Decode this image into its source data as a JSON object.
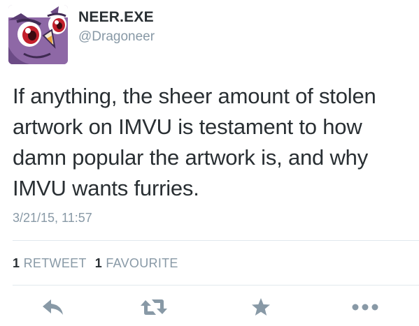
{
  "user": {
    "name": "NEER.EXE",
    "handle": "@Dragoneer"
  },
  "tweet": {
    "text": "If anything, the sheer amount of stolen\nartwork on IMVU is testament to how\ndamn popular the artwork is, and why\nIMVU wants furries.",
    "timestamp": "3/21/15, 11:57"
  },
  "stats": {
    "retweet_count": "1",
    "retweet_label": "RETWEET",
    "favourite_count": "1",
    "favourite_label": "FAVOURITE"
  },
  "actions": {
    "icons": [
      "reply-icon",
      "retweet-icon",
      "favorite-icon",
      "more-icon"
    ]
  },
  "colors": {
    "primary_text": "#292f33",
    "secondary_text": "#8899a6",
    "icon": "#8899a6",
    "divider": "#e1e8ed"
  }
}
